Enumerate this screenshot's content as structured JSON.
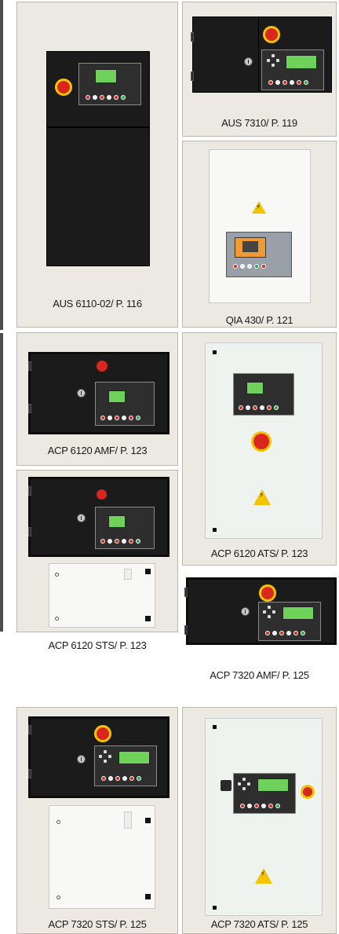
{
  "captions": {
    "aus6110": "AUS 6110-02/ P. 116",
    "aus7310": "AUS 7310/ P. 119",
    "qia430": "QIA 430/ P. 121",
    "acp6120amf": "ACP 6120 AMF/ P. 123",
    "acp6120ats": "ACP 6120 ATS/ P. 123",
    "acp6120sts": "ACP 6120 STS/ P. 123",
    "acp7320amf": "ACP 7320 AMF/ P. 125",
    "acp7320sts": "ACP 7320 STS/ P. 125",
    "acp7320ats": "ACP 7320 ATS/ P. 125"
  },
  "colors": {
    "card_bg": "#ece9e3",
    "panel_dark": "#1b1b1b",
    "estop_red": "#d9271e",
    "estop_ring": "#f5c400",
    "display_green": "#6fd05a",
    "warning_yellow": "#f5c400"
  },
  "icons": [
    "emergency-stop-icon",
    "door-lock-icon",
    "warning-high-voltage-icon",
    "controller-display-icon",
    "navigation-pad-icon"
  ]
}
